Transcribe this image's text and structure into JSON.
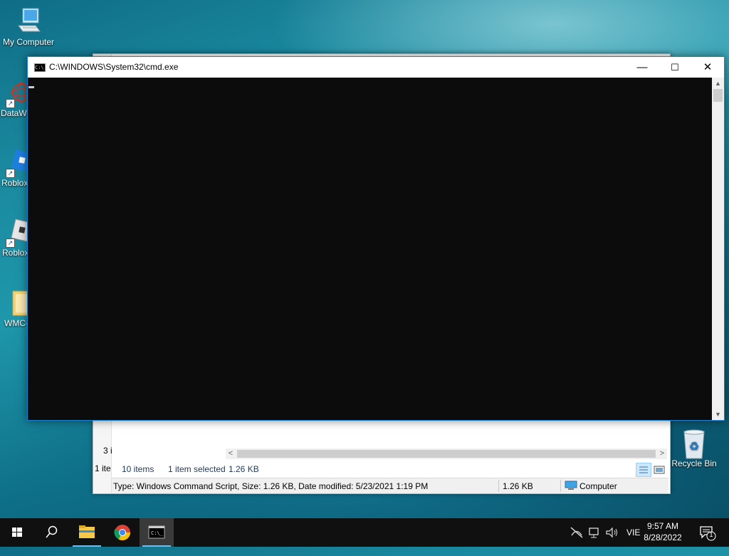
{
  "desktop": {
    "icons": [
      {
        "label": "My Computer"
      },
      {
        "label": "DataW"
      },
      {
        "label": "Roblox"
      },
      {
        "label": "Roblox"
      },
      {
        "label": "WMC-"
      },
      {
        "label": "Recycle Bin"
      }
    ]
  },
  "explorer": {
    "left_text_1": "3 i",
    "left_text_2": "1 ite",
    "status": {
      "item_count": "10 items",
      "selection": "1 item selected",
      "selection_size": "1.26 KB"
    },
    "details_bar": {
      "info": "Type: Windows Command Script, Size: 1.26 KB, Date modified: 5/23/2021 1:19 PM",
      "size": "1.26 KB",
      "location": "Computer"
    }
  },
  "cmd": {
    "title": "C:\\WINDOWS\\System32\\cmd.exe",
    "minimize": "—",
    "maximize": "☐",
    "close": "✕"
  },
  "taskbar": {
    "language": "VIE",
    "time": "9:57 AM",
    "date": "8/28/2022",
    "notification_count": "1"
  },
  "colors": {
    "console_bg": "#0c0c0c",
    "window_border": "#1883d7",
    "taskbar_bg": "#101010"
  }
}
